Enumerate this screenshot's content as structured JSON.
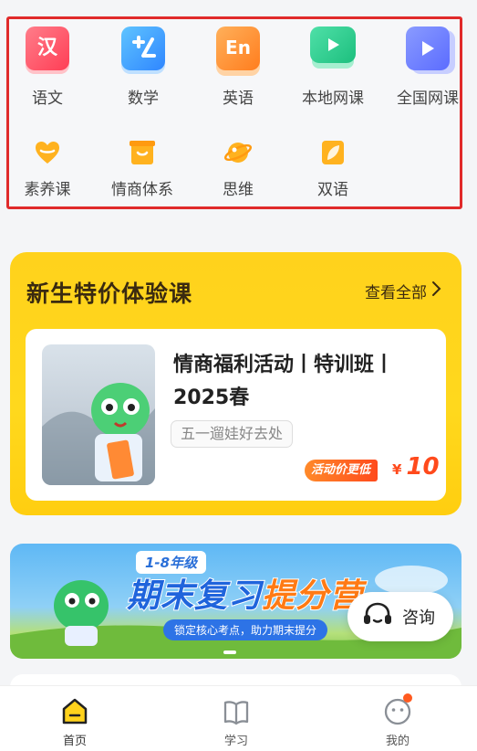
{
  "categories": {
    "row1": [
      {
        "label": "语文",
        "icon": "chinese-icon",
        "glyph": "汉"
      },
      {
        "label": "数学",
        "icon": "math-icon",
        "glyph": ""
      },
      {
        "label": "英语",
        "icon": "english-icon",
        "glyph": "En"
      },
      {
        "label": "本地网课",
        "icon": "local-video-icon",
        "glyph": ""
      },
      {
        "label": "全国网课",
        "icon": "national-video-icon",
        "glyph": ""
      }
    ],
    "row2": [
      {
        "label": "素养课",
        "icon": "heart-icon"
      },
      {
        "label": "情商体系",
        "icon": "box-icon"
      },
      {
        "label": "思维",
        "icon": "planet-icon"
      },
      {
        "label": "双语",
        "icon": "leaf-icon"
      }
    ]
  },
  "promo": {
    "title": "新生特价体验课",
    "more_label": "查看全部",
    "course": {
      "title": "情商福利活动丨特训班丨2025春",
      "tag": "五一遛娃好去处",
      "price_badge": "活动价更低",
      "currency": "¥",
      "price": "10"
    }
  },
  "banner": {
    "grade": "1-8年级",
    "main_a": "期末复习",
    "main_b": "提分营",
    "sub": "锁定核心考点，助力期末提分"
  },
  "consult": {
    "label": "咨询"
  },
  "tabbar": {
    "items": [
      {
        "label": "首页"
      },
      {
        "label": "学习"
      },
      {
        "label": "我的"
      }
    ]
  },
  "colors": {
    "accent_yellow": "#ffd21c",
    "price_orange": "#ff4a1c",
    "highlight_border": "#e02a2a"
  }
}
